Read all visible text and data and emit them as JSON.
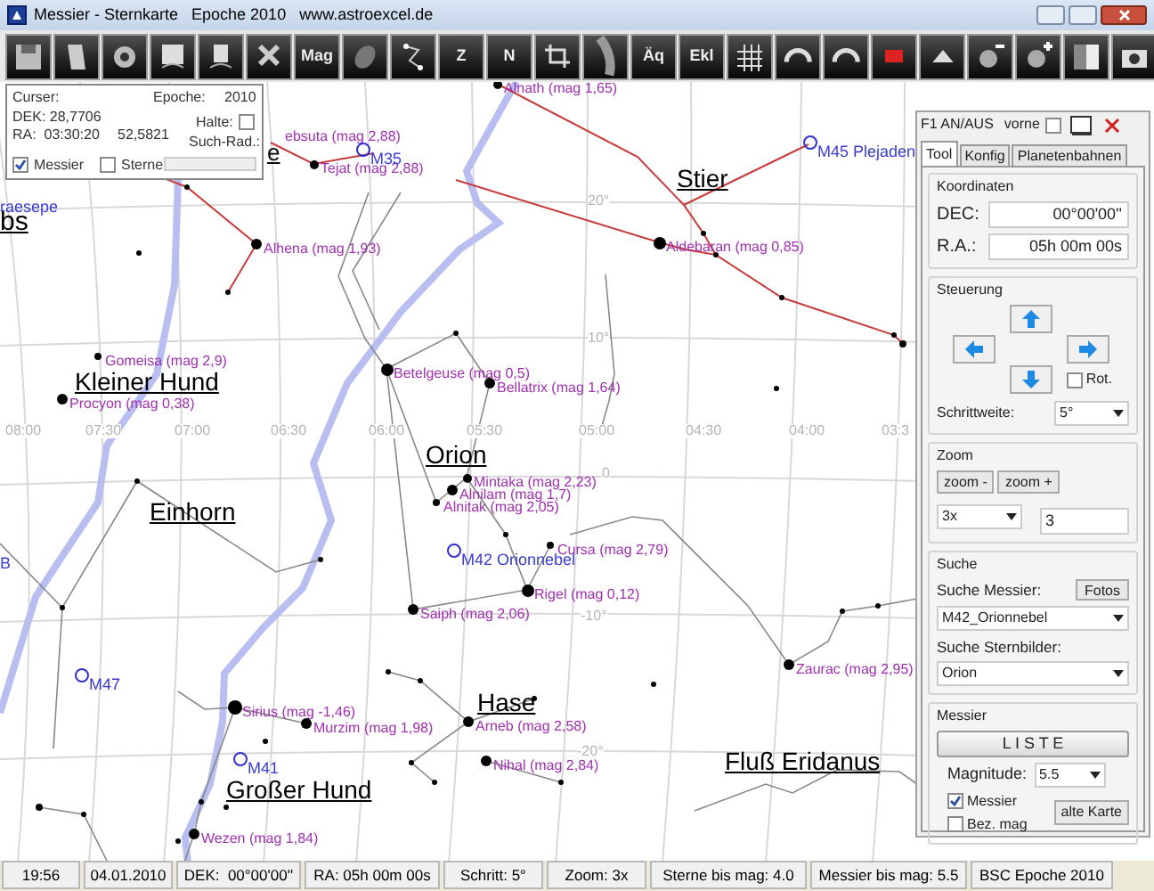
{
  "window": {
    "title": "Messier - Sternkarte   Epoche 2010   www.astroexcel.de"
  },
  "toolbar": [
    {
      "kind": "save"
    },
    {
      "kind": "book"
    },
    {
      "kind": "gear"
    },
    {
      "kind": "copy"
    },
    {
      "kind": "page"
    },
    {
      "kind": "delete"
    },
    {
      "kind": "text",
      "label": "Mag"
    },
    {
      "kind": "nebula"
    },
    {
      "kind": "figure"
    },
    {
      "kind": "text",
      "label": "Z"
    },
    {
      "kind": "text",
      "label": "N"
    },
    {
      "kind": "frame"
    },
    {
      "kind": "band"
    },
    {
      "kind": "text",
      "label": "Äq"
    },
    {
      "kind": "text",
      "label": "Ekl"
    },
    {
      "kind": "grid"
    },
    {
      "kind": "rotate"
    },
    {
      "kind": "rotate"
    },
    {
      "kind": "flag"
    },
    {
      "kind": "up"
    },
    {
      "kind": "zoomout"
    },
    {
      "kind": "zoomin"
    },
    {
      "kind": "gradient"
    },
    {
      "kind": "camera"
    }
  ],
  "info_box": {
    "cursor_label": "Curser:",
    "epoch_label": "Epoche:",
    "epoch": "2010",
    "dec": "DEK: 28,7706",
    "ra": "RA:  03:30:20",
    "ra_value": "52,5821",
    "hold": {
      "label": "Halte:",
      "checked": false
    },
    "search_radius_label": "Such-Rad.:",
    "messier": {
      "label": "Messier",
      "checked": true
    },
    "stars": {
      "label": "Sterne",
      "checked": false
    }
  },
  "map": {
    "ra_labels": [
      "08:00",
      "07:30",
      "07:00",
      "06:30",
      "06:00",
      "05:30",
      "05:00",
      "04:30",
      "04:00",
      "03:3"
    ],
    "dec_labels": [
      "20°",
      "10°",
      "0",
      "-10°",
      "-20°"
    ],
    "constellations": [
      "bs",
      "e",
      "Kleiner Hund",
      "Orion",
      "Einhorn",
      "Stier",
      "Hase",
      "Großer Hund",
      "Fluß Eridanus"
    ],
    "stars": [
      "Alnath (mag 1,65)",
      "ebsuta (mag 2,88)",
      "Tejat (mag 2,88)",
      "Alhena (mag 1,93)",
      "Gomeisa (mag 2,9)",
      "Procyon (mag 0,38)",
      "Betelgeuse (mag 0,5)",
      "Bellatrix (mag 1,64)",
      "Mintaka (mag 2,23)",
      "Alnilam (mag 1,7)",
      "Alnitak (mag 2,05)",
      "Cursa (mag 2,79)",
      "Rigel (mag 0,12)",
      "Saiph (mag 2,06)",
      "Aldebaran (mag 0,85)",
      "Zaurac (mag 2,95)",
      "Sirius (mag -1,46)",
      "Murzim (mag 1,98)",
      "Arneb (mag 2,58)",
      "Nihal (mag 2,84)",
      "Wezen (mag 1,84)"
    ],
    "messier": [
      "M35",
      "M42 Orionnebel",
      "M47",
      "M41",
      "M45 Plejaden",
      "raesepe",
      "B"
    ]
  },
  "panel": {
    "hint": "F1 AN/AUS",
    "front": {
      "label": "vorne",
      "checked": false
    },
    "tabs": [
      {
        "label": "Tool",
        "selected": true
      },
      {
        "label": "Konfig",
        "selected": false
      },
      {
        "label": "Planetenbahnen",
        "selected": false
      }
    ],
    "coordinates": {
      "title": "Koordinaten",
      "dec_label": "DEC:",
      "dec": "00°00'00''",
      "ra_label": "R.A.:",
      "ra": "05h 00m 00s"
    },
    "control": {
      "title": "Steuerung",
      "rotate": {
        "label": "Rot.",
        "checked": false
      },
      "step_label": "Schrittweite:",
      "step": "5°"
    },
    "zoom": {
      "title": "Zoom",
      "zoom_out": "zoom -",
      "zoom_in": "zoom +",
      "factor": "3x",
      "value": "3"
    },
    "search": {
      "title": "Suche",
      "messier_label": "Suche Messier:",
      "photos": "Fotos",
      "messier": "M42_Orionnebel",
      "constellation_label": "Suche Sternbilder:",
      "constellation": "Orion"
    },
    "messier": {
      "title": "Messier",
      "list": "L I S T E",
      "magnitude_label": "Magnitude:",
      "magnitude": "5.5",
      "show_messier": {
        "label": "Messier",
        "checked": true
      },
      "label_mag": {
        "label": "Bez. mag",
        "checked": false
      },
      "old_map": "alte Karte"
    }
  },
  "status_bar": [
    "19:56",
    "04.01.2010",
    "DEK:  00°00'00''",
    "RA: 05h 00m 00s",
    "Schritt: 5°",
    "Zoom: 3x",
    "Sterne bis mag: 4.0",
    "Messier bis mag: 5.5",
    "BSC Epoche 2010"
  ]
}
